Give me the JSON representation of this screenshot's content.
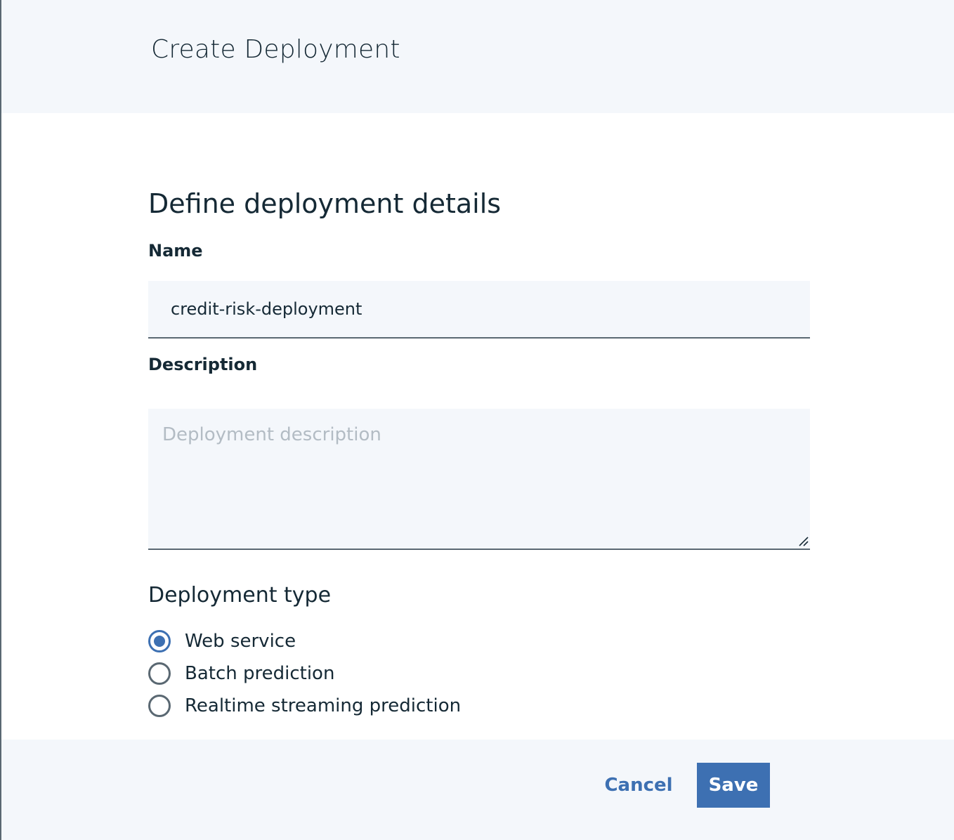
{
  "dialog": {
    "title": "Create Deployment",
    "section_title": "Define deployment details"
  },
  "name_field": {
    "label": "Name",
    "value": "credit-risk-deployment"
  },
  "description_field": {
    "label": "Description",
    "value": "",
    "placeholder": "Deployment description"
  },
  "deployment_type": {
    "title": "Deployment type",
    "selected": "Web service",
    "options": [
      {
        "label": "Web service",
        "selected": true
      },
      {
        "label": "Batch prediction",
        "selected": false
      },
      {
        "label": "Realtime streaming prediction",
        "selected": false
      }
    ]
  },
  "footer": {
    "cancel_label": "Cancel",
    "save_label": "Save"
  },
  "colors": {
    "accent": "#3d70b2",
    "text": "#152935",
    "panel_background": "#f4f7fb",
    "border": "#5a6872",
    "placeholder": "#b3bcc4"
  },
  "icons": {
    "resize_handle": "resize-handle-icon"
  }
}
